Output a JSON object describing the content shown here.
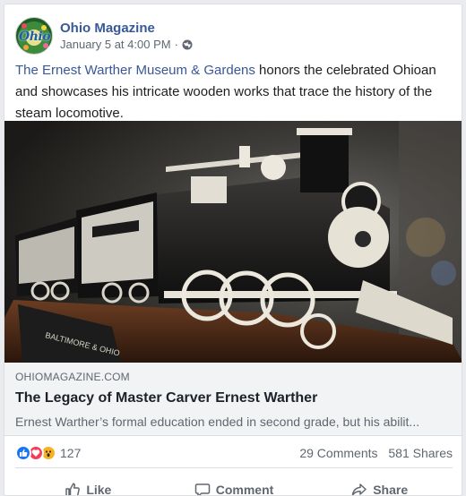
{
  "post": {
    "page_name": "Ohio Magazine",
    "avatar_text": "Ohio",
    "timestamp": "January 5 at 4:00 PM",
    "separator": "·",
    "privacy_icon": "globe-icon",
    "text_link": "The Ernest Warther Museum & Gardens",
    "text_rest": " honors the celebrated Ohioan and showcases his intricate wooden works that trace the history of the steam locomotive."
  },
  "image": {
    "plaque_text": "BALTIMORE & OHIO"
  },
  "link_preview": {
    "domain": "OHIOMAGAZINE.COM",
    "title": "The Legacy of Master Carver Ernest Warther",
    "description": "Ernest Warther’s formal education ended in second grade, but his abilit..."
  },
  "stats": {
    "reactions": [
      "like-icon",
      "love-icon",
      "wow-icon"
    ],
    "reaction_count": "127",
    "comments": "29 Comments",
    "shares": "581 Shares"
  },
  "actions": {
    "like": "Like",
    "comment": "Comment",
    "share": "Share"
  },
  "colors": {
    "link": "#385898",
    "like_blue": "#1877f2",
    "love_red": "#f33e58",
    "wow_yellow": "#f7b125"
  }
}
